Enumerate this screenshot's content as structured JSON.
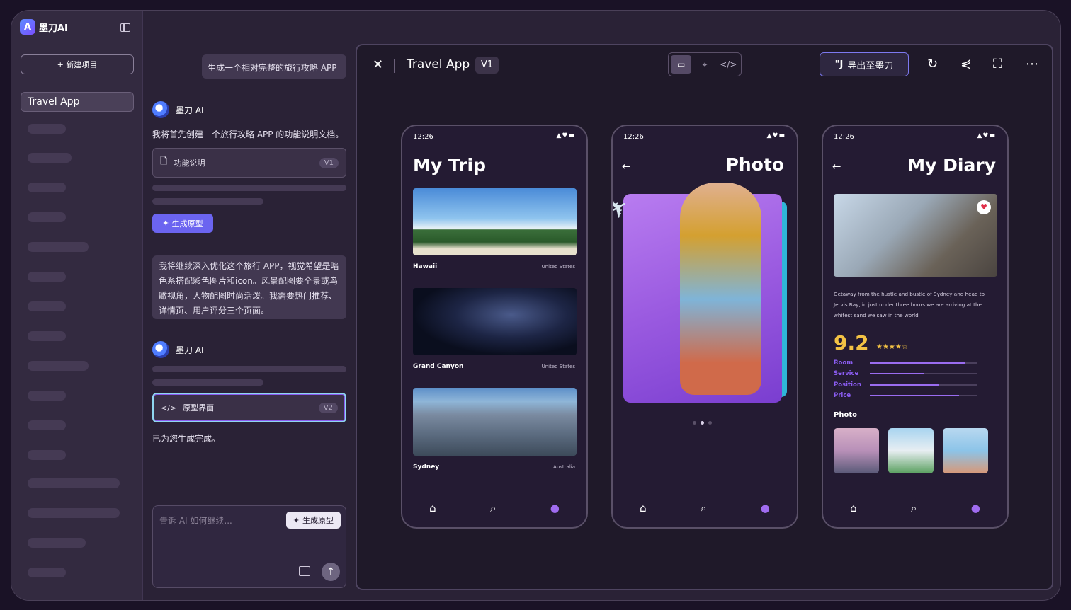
{
  "sidebar": {
    "logo": "墨刀AI",
    "new_project": "+ 新建项目",
    "project": "Travel App"
  },
  "chat": {
    "user_msg_1": "生成一个相对完整的旅行攻略 APP",
    "ai_name": "墨刀 AI",
    "ai_msg_1": "我将首先创建一个旅行攻略 APP 的功能说明文档。",
    "doc_1": {
      "name": "功能说明",
      "version": "V1"
    },
    "gen_button": "生成原型",
    "user_msg_2": "我将继续深入优化这个旅行 APP，视觉希望是暗色系搭配彩色图片和icon。风景配图要全景或鸟瞰视角，人物配图时尚活泼。我需要热门推荐、详情页、用户评分三个页面。",
    "ai_name_2": "墨刀 AI",
    "doc_2": {
      "name": "原型界面",
      "version": "V2"
    },
    "done_msg": "已为您生成完成。",
    "input_placeholder": "告诉 AI 如何继续...",
    "input_gen": "生成原型"
  },
  "preview": {
    "title": "Travel App",
    "version": "V1",
    "export_label": "导出至墨刀",
    "phones": [
      {
        "time": "12:26",
        "title": "My Trip",
        "cards": [
          {
            "name": "Hawaii",
            "location": "United States"
          },
          {
            "name": "Grand Canyon",
            "location": "United States"
          },
          {
            "name": "Sydney",
            "location": "Australia"
          }
        ]
      },
      {
        "time": "12:26",
        "title": "Photo"
      },
      {
        "time": "12:26",
        "title": "My Diary",
        "text": "Getaway from the hustle and bustle of Sydney and head to Jervis Bay, in just under three hours we are arriving at the whitest sand we saw in the world",
        "score": "9.2",
        "ratings": [
          {
            "label": "Room",
            "value": 0.88
          },
          {
            "label": "Service",
            "value": 0.5
          },
          {
            "label": "Position",
            "value": 0.64
          },
          {
            "label": "Price",
            "value": 0.83
          }
        ],
        "photo_section": "Photo"
      }
    ]
  }
}
